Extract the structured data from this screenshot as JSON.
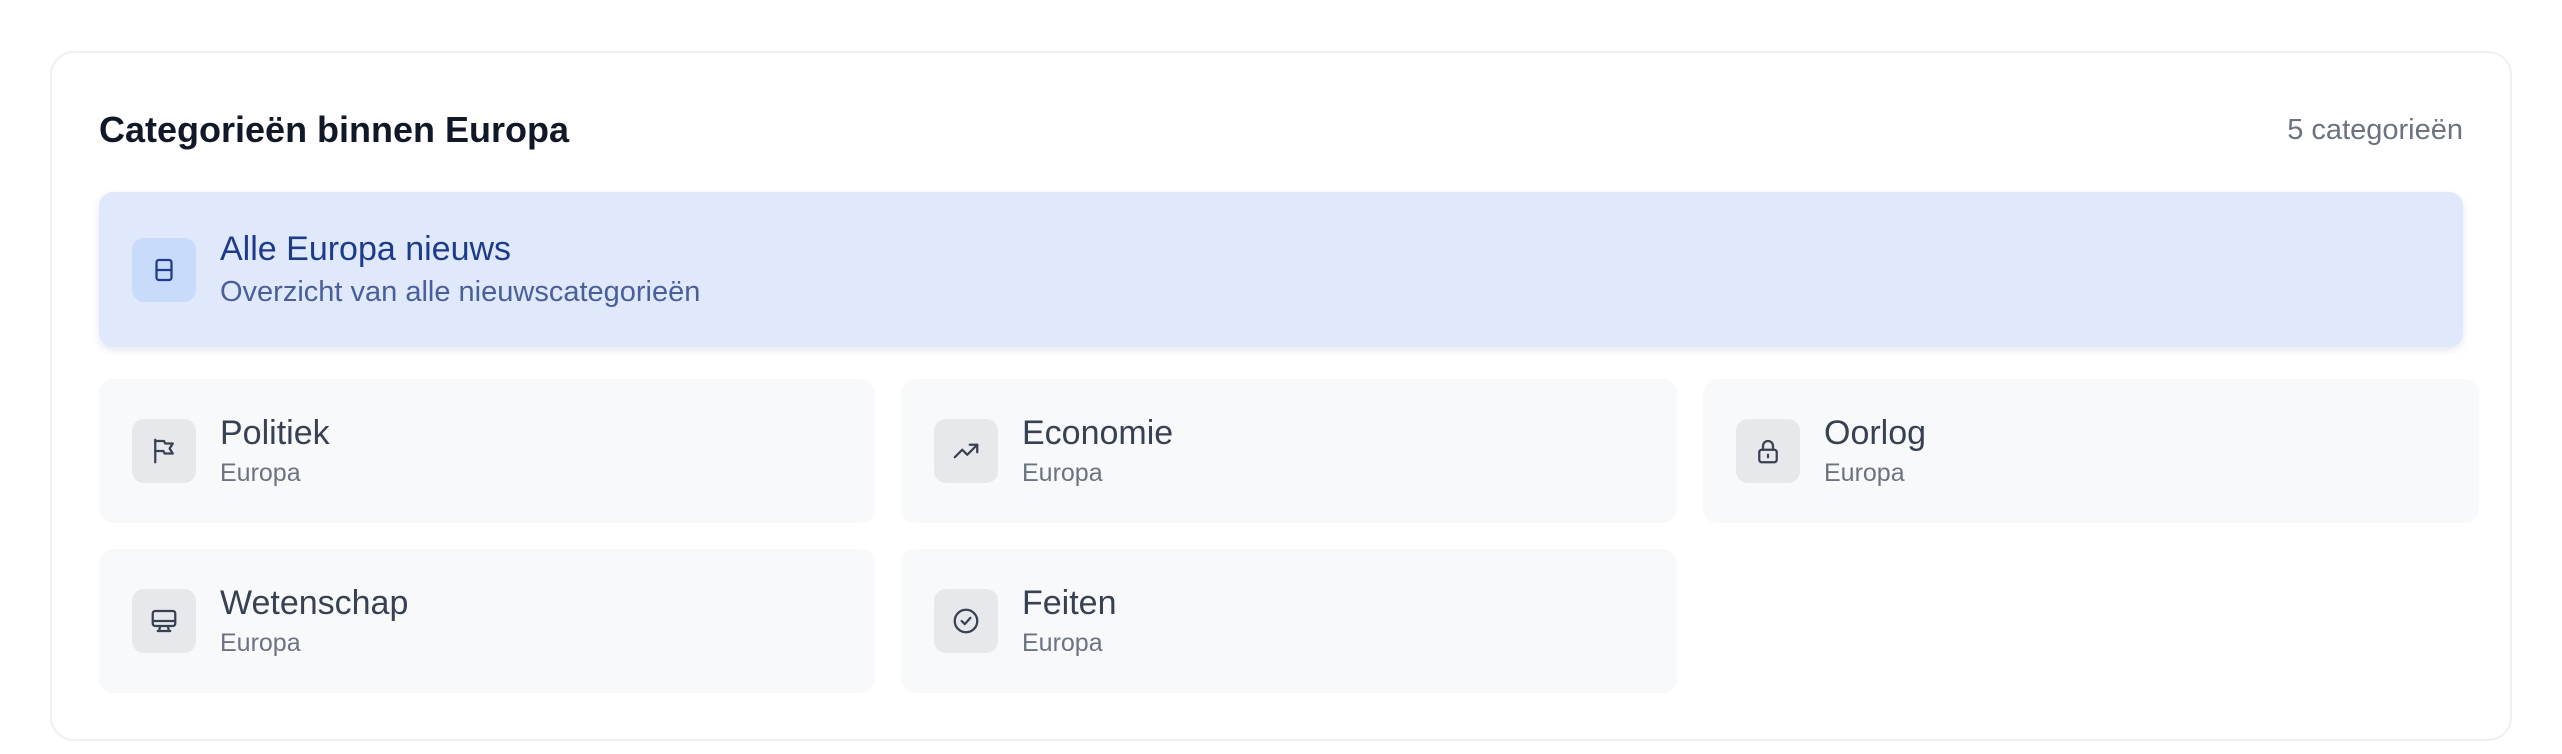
{
  "header": {
    "title": "Categorieën binnen Europa",
    "count": "5 categorieën"
  },
  "featured": {
    "title": "Alle Europa nieuws",
    "subtitle": "Overzicht van alle nieuwscategorieën",
    "icon": "newspaper-icon"
  },
  "categories": [
    {
      "name": "Politiek",
      "region": "Europa",
      "icon": "flag-icon"
    },
    {
      "name": "Economie",
      "region": "Europa",
      "icon": "trending-up-icon"
    },
    {
      "name": "Oorlog",
      "region": "Europa",
      "icon": "lock-icon"
    },
    {
      "name": "Wetenschap",
      "region": "Europa",
      "icon": "monitor-icon"
    },
    {
      "name": "Feiten",
      "region": "Europa",
      "icon": "check-circle-icon"
    }
  ],
  "colors": {
    "featured_bg": "#dfe9fb",
    "featured_text": "#1e3a8a",
    "card_bg": "#f8f9fb",
    "title_text": "#111827"
  }
}
